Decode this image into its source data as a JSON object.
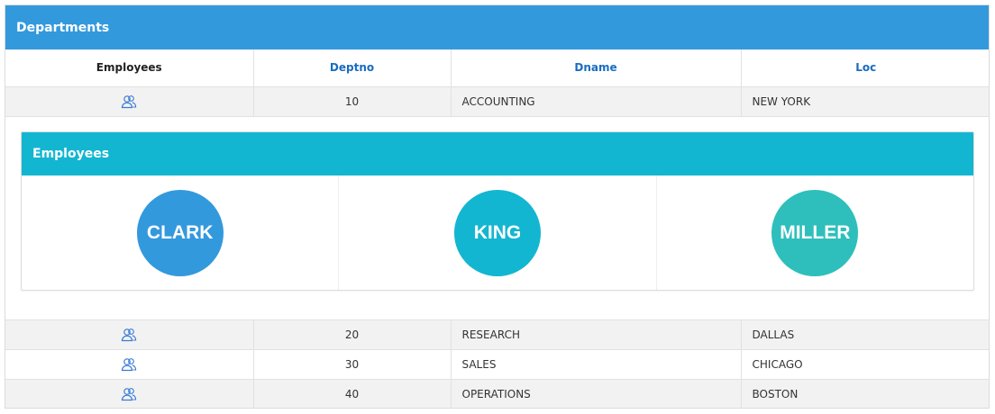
{
  "region": {
    "title": "Departments"
  },
  "columns": {
    "employees": "Employees",
    "deptno": "Deptno",
    "dname": "Dname",
    "loc": "Loc"
  },
  "rows": [
    {
      "deptno": "10",
      "dname": "ACCOUNTING",
      "loc": "NEW YORK",
      "icon": "people-icon"
    },
    {
      "deptno": "20",
      "dname": "RESEARCH",
      "loc": "DALLAS",
      "icon": "people-icon"
    },
    {
      "deptno": "30",
      "dname": "SALES",
      "loc": "CHICAGO",
      "icon": "people-icon"
    },
    {
      "deptno": "40",
      "dname": "OPERATIONS",
      "loc": "BOSTON",
      "icon": "people-icon"
    }
  ],
  "detail": {
    "title": "Employees",
    "employees": [
      {
        "name": "CLARK",
        "color": "#3399dd"
      },
      {
        "name": "KING",
        "color": "#13b6d0"
      },
      {
        "name": "MILLER",
        "color": "#2ebfbc"
      }
    ]
  },
  "colors": {
    "region_header": "#3399dd",
    "card_header": "#13b6d0",
    "link": "#1a6cc0",
    "icon": "#3a7bd5"
  }
}
